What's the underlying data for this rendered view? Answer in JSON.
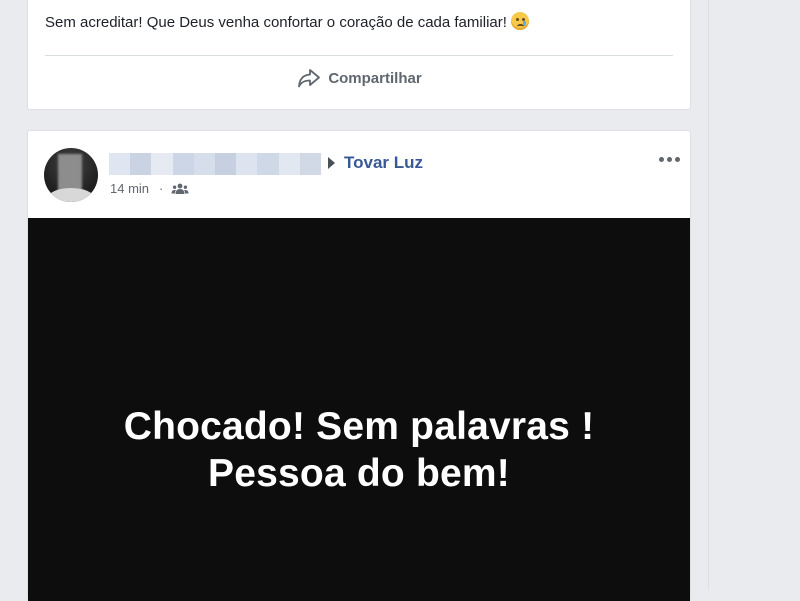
{
  "previous_post": {
    "text": "Sem acreditar! Que Deus venha confortar o coração de cada familiar!",
    "emoji_icon": "sad-tear-emoji-icon",
    "share_label": "Compartilhar",
    "share_icon": "share-arrow-icon"
  },
  "post": {
    "author_name_blurred": true,
    "page_name": "Tovar Luz",
    "time": "14 min",
    "separator": "·",
    "audience_icon": "friends-icon",
    "more_icon": "more-options-icon",
    "image_text_line1": "Chocado! Sem palavras !",
    "image_text_line2": "Pessoa do bem!"
  },
  "colors": {
    "link": "#385898",
    "background": "#e9ebee",
    "card": "#ffffff",
    "image_bg": "#0d0d0d"
  }
}
